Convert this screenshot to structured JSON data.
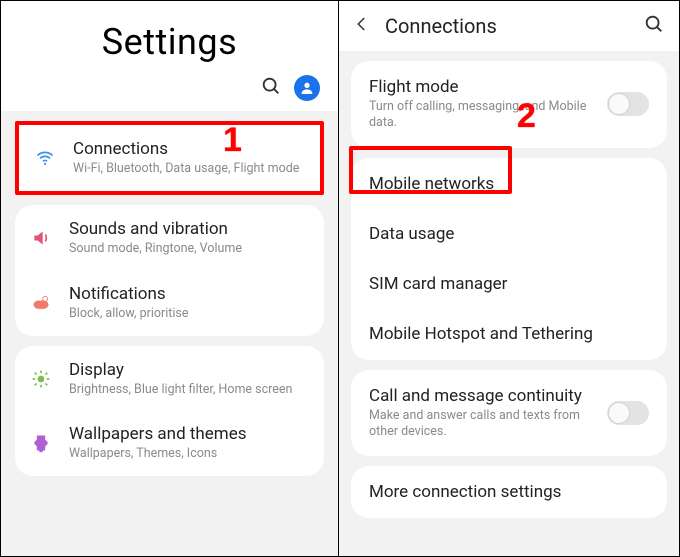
{
  "left": {
    "title": "Settings",
    "groups": [
      {
        "highlight": true,
        "items": [
          {
            "icon": "wifi",
            "color": "#3b8ef0",
            "title": "Connections",
            "sub": "Wi-Fi, Bluetooth, Data usage, Flight mode"
          }
        ]
      },
      {
        "items": [
          {
            "icon": "sound",
            "color": "#e0567b",
            "title": "Sounds and vibration",
            "sub": "Sound mode, Ringtone, Volume"
          },
          {
            "icon": "notif",
            "color": "#f07b6c",
            "title": "Notifications",
            "sub": "Block, allow, prioritise"
          }
        ]
      },
      {
        "items": [
          {
            "icon": "display",
            "color": "#7cc04b",
            "title": "Display",
            "sub": "Brightness, Blue light filter, Home screen"
          },
          {
            "icon": "wall",
            "color": "#b05fd1",
            "title": "Wallpapers and themes",
            "sub": "Wallpapers, Themes, Icons"
          }
        ]
      }
    ]
  },
  "right": {
    "title": "Connections",
    "groups": [
      {
        "items": [
          {
            "title": "Flight mode",
            "sub": "Turn off calling, messaging, and Mobile data.",
            "toggle": true
          }
        ]
      },
      {
        "items": [
          {
            "title": "Mobile networks",
            "highlight": true
          },
          {
            "title": "Data usage"
          },
          {
            "title": "SIM card manager"
          },
          {
            "title": "Mobile Hotspot and Tethering"
          }
        ]
      },
      {
        "items": [
          {
            "title": "Call and message continuity",
            "sub": "Make and answer calls and texts from other devices.",
            "toggle": true
          }
        ]
      },
      {
        "items": [
          {
            "title": "More connection settings"
          }
        ]
      }
    ]
  },
  "annotations": {
    "step1": "1",
    "step2": "2"
  }
}
